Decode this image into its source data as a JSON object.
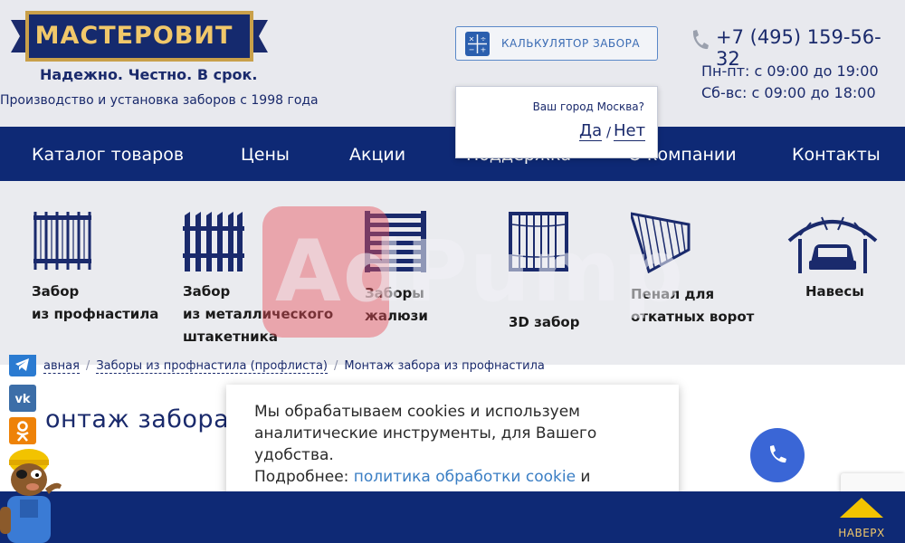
{
  "header": {
    "logo_text": "МАСТЕРОВИТ",
    "slogan": "Надежно. Честно. В срок.",
    "since": "Производство и установка заборов с 1998 года",
    "calculator_label": "КАЛЬКУЛЯТОР ЗАБОРА",
    "phone": "+7 (495) 159-56-32",
    "hours_weekdays": "Пн-пт: с 09:00 до 19:00",
    "hours_weekend": "Сб-вс: с 09:00 до 18:00"
  },
  "nav": {
    "items": [
      {
        "label": "Каталог товаров"
      },
      {
        "label": "Цены"
      },
      {
        "label": "Акции"
      },
      {
        "label": "Поддержка"
      },
      {
        "label": "О компании"
      },
      {
        "label": "Контакты"
      }
    ]
  },
  "city_popup": {
    "question": "Ваш город Москва?",
    "yes": "Да",
    "separator": "/",
    "no": "Нет"
  },
  "catalog": {
    "items": [
      {
        "line1": "Забор",
        "line2": "из профнастила",
        "line3": ""
      },
      {
        "line1": "Забор",
        "line2": "из металлического",
        "line3": "штакетника"
      },
      {
        "line1": "Заборы",
        "line2": "жалюзи",
        "line3": ""
      },
      {
        "line1": "3D забор",
        "line2": "",
        "line3": ""
      },
      {
        "line1": "Пенал для",
        "line2": "откатных ворот",
        "line3": ""
      },
      {
        "line1": "Навесы",
        "line2": "",
        "line3": ""
      }
    ]
  },
  "watermark": "AdPump",
  "breadcrumb": {
    "items": [
      "авная",
      "Заборы из профнастила (профлиста)",
      "Монтаж забора из профнастила"
    ],
    "separator": "/"
  },
  "page_title": "онтаж забора и",
  "cookie": {
    "text": "Мы обрабатываем cookies и используем аналитические инструменты, для Вашего удобства.",
    "more_prefix": "Подробнее: ",
    "link": "политика обработки cookie",
    "suffix": " и"
  },
  "to_top_label": "НАВЕРХ",
  "colors": {
    "brand_navy": "#0e2975",
    "gold": "#f1c86a",
    "accent_blue": "#3a66d6"
  },
  "icons": {
    "phone": "phone-icon",
    "calculator": "calculator-icon",
    "telegram": "telegram-icon",
    "vk": "vk-icon",
    "ok": "odnoklassniki-icon",
    "call": "call-icon",
    "up": "arrow-up-icon"
  }
}
